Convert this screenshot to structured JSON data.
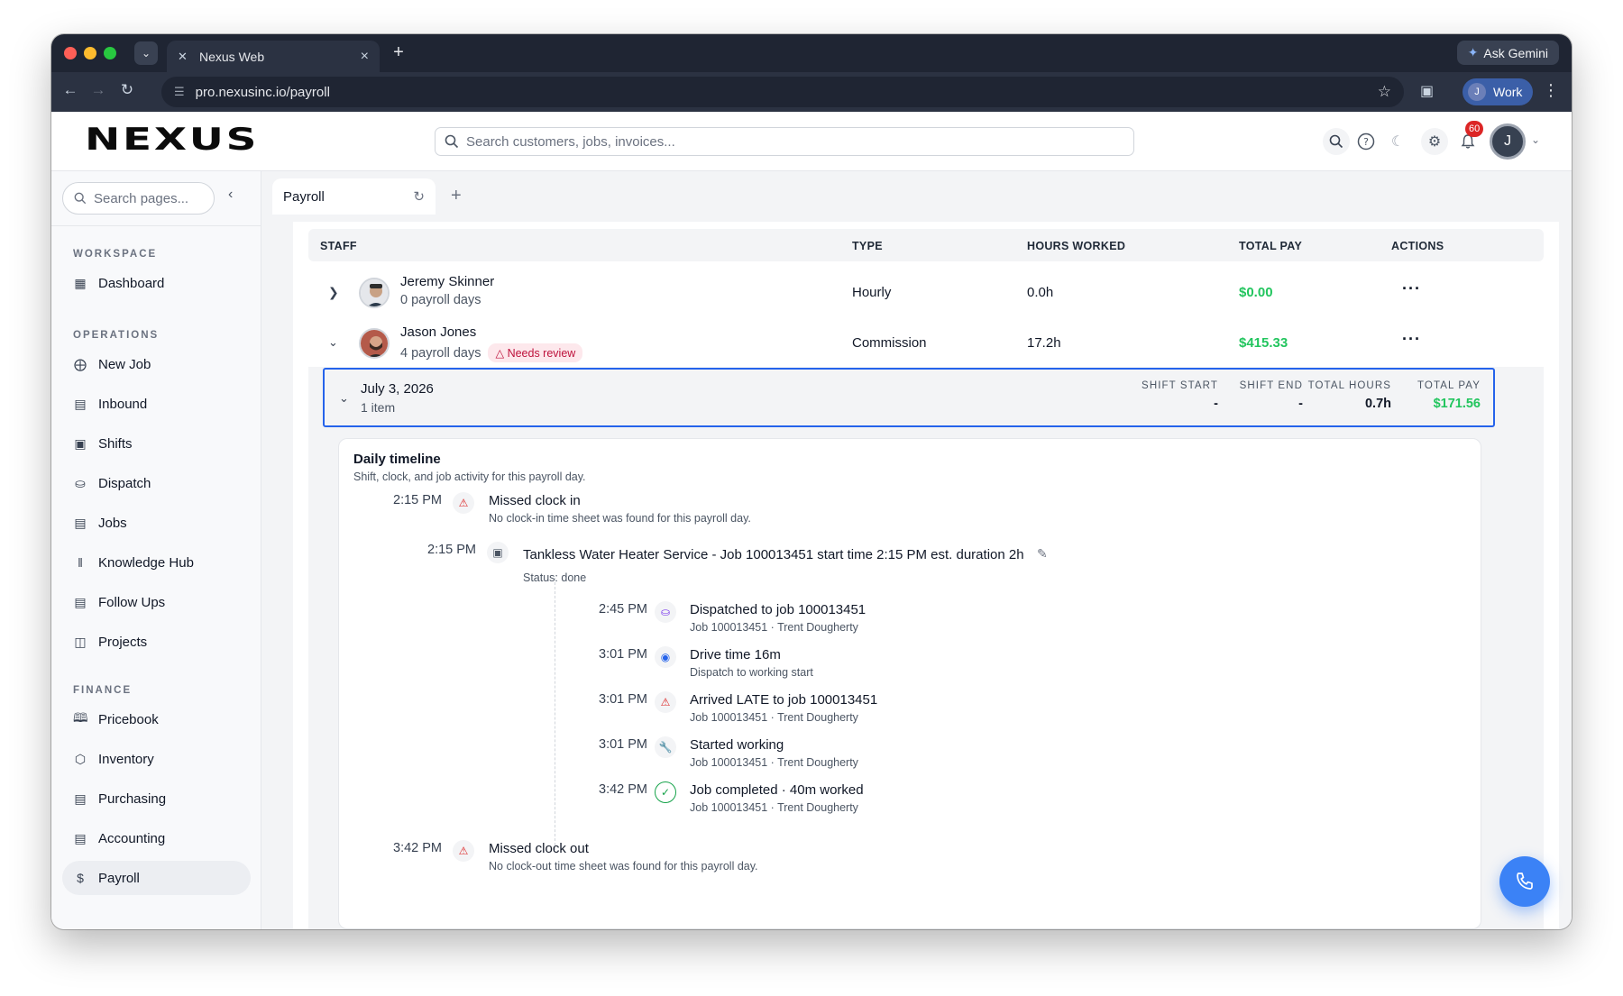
{
  "browser": {
    "tab_title": "Nexus Web",
    "url": "pro.nexusinc.io/payroll",
    "gemini_label": "Ask Gemini",
    "profile_initial": "J",
    "profile_label": "Work"
  },
  "header": {
    "logo": "NEXUS",
    "search_placeholder": "Search customers, jobs, invoices...",
    "notification_count": "60",
    "user_initial": "J"
  },
  "sidebar": {
    "search_placeholder": "Search pages...",
    "sections": {
      "workspace": "WORKSPACE",
      "operations": "OPERATIONS",
      "finance": "FINANCE"
    },
    "items": {
      "dashboard": "Dashboard",
      "new_job": "New Job",
      "inbound": "Inbound",
      "shifts": "Shifts",
      "dispatch": "Dispatch",
      "jobs": "Jobs",
      "knowledge_hub": "Knowledge Hub",
      "follow_ups": "Follow Ups",
      "projects": "Projects",
      "pricebook": "Pricebook",
      "inventory": "Inventory",
      "purchasing": "Purchasing",
      "accounting": "Accounting",
      "payroll": "Payroll"
    }
  },
  "page_tab": {
    "label": "Payroll"
  },
  "table": {
    "columns": {
      "staff": "STAFF",
      "type": "TYPE",
      "hours": "HOURS WORKED",
      "pay": "TOTAL PAY",
      "actions": "ACTIONS"
    },
    "rows": [
      {
        "name": "Jeremy Skinner",
        "days": "0 payroll days",
        "type": "Hourly",
        "hours": "0.0h",
        "pay": "$0.00",
        "actions": "···"
      },
      {
        "name": "Jason Jones",
        "days": "4 payroll days",
        "badge": "Needs review",
        "type": "Commission",
        "hours": "17.2h",
        "pay": "$415.33",
        "actions": "···"
      }
    ]
  },
  "day": {
    "date": "July 3, 2026",
    "count": "1 item",
    "shift_start_label": "SHIFT START",
    "shift_start": "-",
    "shift_end_label": "SHIFT END",
    "shift_end": "-",
    "total_hours_label": "TOTAL HOURS",
    "total_hours": "0.7h",
    "total_pay_label": "TOTAL PAY",
    "total_pay": "$171.56"
  },
  "timeline": {
    "title": "Daily timeline",
    "subtitle": "Shift, clock, and job activity for this payroll day.",
    "missed_in": {
      "time": "2:15 PM",
      "title": "Missed clock in",
      "sub": "No clock-in time sheet was found for this payroll day."
    },
    "job": {
      "time": "2:15 PM",
      "title": "Tankless Water Heater Service - Job 100013451 start time 2:15 PM est. duration 2h",
      "status": "Status: done"
    },
    "events": [
      {
        "time": "2:45 PM",
        "title": "Dispatched to job 100013451",
        "sub": "Job 100013451 · Trent Dougherty"
      },
      {
        "time": "3:01 PM",
        "title": "Drive time 16m",
        "sub": "Dispatch to working start"
      },
      {
        "time": "3:01 PM",
        "title": "Arrived LATE to job 100013451",
        "sub": "Job 100013451 · Trent Dougherty"
      },
      {
        "time": "3:01 PM",
        "title": "Started working",
        "sub": "Job 100013451 · Trent Dougherty"
      },
      {
        "time": "3:42 PM",
        "title": "Job completed · 40m worked",
        "sub": "Job 100013451 · Trent Dougherty"
      }
    ],
    "missed_out": {
      "time": "3:42 PM",
      "title": "Missed clock out",
      "sub": "No clock-out time sheet was found for this payroll day."
    }
  },
  "colors": {
    "accent": "#2563eb",
    "pay_green": "#22c55e",
    "warning_red": "#dc2626",
    "fab_blue": "#3b82f6"
  }
}
